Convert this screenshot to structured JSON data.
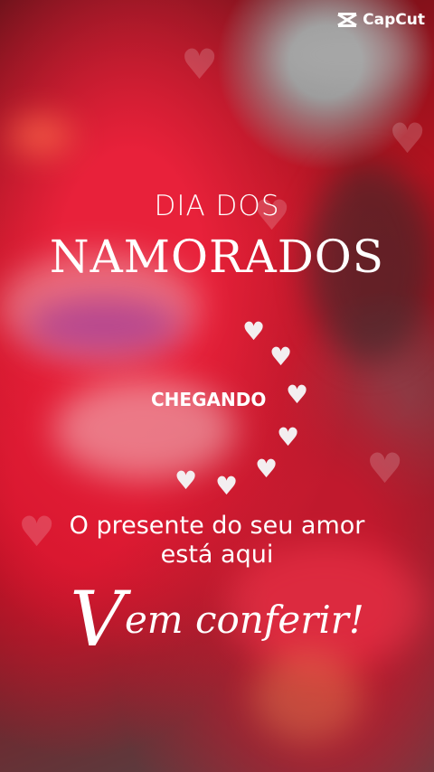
{
  "watermark": {
    "brand": "CapCut",
    "icon": "capcut-logo-icon"
  },
  "headline": {
    "line1": "DIA DOS",
    "line2": "NAMORADOS"
  },
  "teaser": {
    "label": "CHEGANDO",
    "heart_icon": "heart-icon"
  },
  "message": {
    "line1": "O presente do seu amor",
    "line2": "está aqui",
    "cta_initial": "V",
    "cta_rest": "em conferir!"
  },
  "colors": {
    "accent_red": "#d4142c",
    "text": "#ffffff",
    "heart": "#f3eef0"
  }
}
